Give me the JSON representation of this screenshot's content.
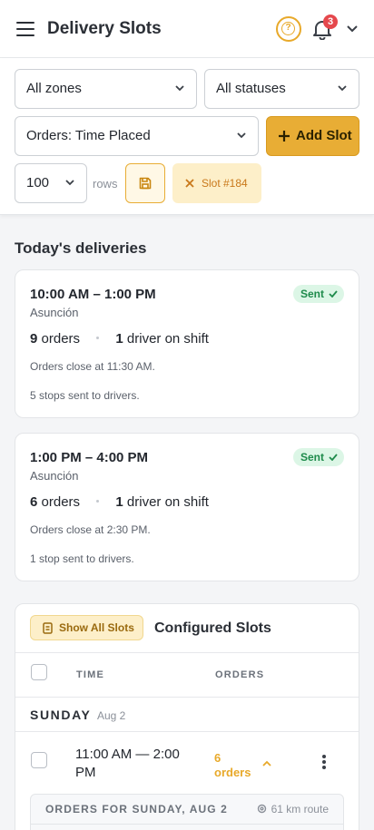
{
  "header": {
    "title": "Delivery Slots",
    "notification_count": "3"
  },
  "filters": {
    "zones": "All zones",
    "statuses": "All statuses",
    "sort": "Orders: Time Placed",
    "add_slot_label": "Add Slot",
    "page_size": "100",
    "rows_label": "rows",
    "slot_chip_label": "Slot #184"
  },
  "today": {
    "heading": "Today's deliveries",
    "cards": [
      {
        "time": "10:00 AM – 1:00 PM",
        "city": "Asunción",
        "status": "Sent",
        "orders": "9",
        "orders_label": "orders",
        "drivers": "1",
        "drivers_label": "driver on shift",
        "cutoff": "Orders close at 11:30 AM.",
        "stops": "5 stops sent to drivers."
      },
      {
        "time": "1:00 PM – 4:00 PM",
        "city": "Asunción",
        "status": "Sent",
        "orders": "6",
        "orders_label": "orders",
        "drivers": "1",
        "drivers_label": "driver on shift",
        "cutoff": "Orders close at 2:30 PM.",
        "stops": "1 stop sent to drivers."
      }
    ]
  },
  "configured": {
    "show_all_label": "Show All Slots",
    "title": "Configured Slots",
    "columns": [
      "TIME",
      "ORDERS"
    ],
    "day": {
      "name": "SUNDAY",
      "date": "Aug 2"
    },
    "slot": {
      "time": "11:00 AM — 2:00 PM",
      "orders": "6 orders"
    },
    "orders_panel": {
      "title": "ORDERS FOR SUNDAY, AUG 2",
      "route": "61 km route"
    }
  },
  "colors": {
    "accent": "#e8ad35",
    "sent_bg": "#dcf6e6",
    "sent_text": "#1e8b4b",
    "badge": "#e5484d"
  }
}
